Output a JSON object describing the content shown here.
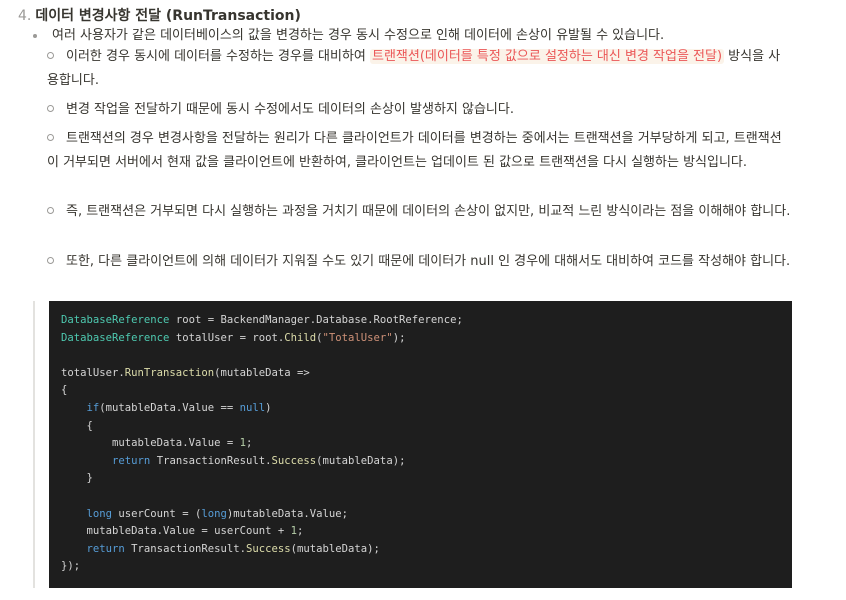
{
  "heading": {
    "number": "4.",
    "title": "데이터 변경사항 전달 (RunTransaction)"
  },
  "intro": "여러 사용자가 같은 데이터베이스의 값을 변경하는 경우 동시 수정으로 인해 데이터에 손상이 유발될 수 있습니다.",
  "sub_items": [
    {
      "before": "이러한 경우 동시에 데이터를 수정하는 경우를 대비하여 ",
      "highlight": "트랜잭션(데이터를 특정 값으로 설정하는 대신 변경 작업을 전달)",
      "after": " 방식을 사용합니다."
    },
    {
      "text": "변경 작업을 전달하기 때문에 동시 수정에서도 데이터의 손상이 발생하지 않습니다."
    },
    {
      "text": "트랜잭션의 경우 변경사항을 전달하는 원리가 다른 클라이언트가 데이터를 변경하는 중에서는 트랜잭션을 거부당하게 되고, 트랜잭션이 거부되면 서버에서 현재 값을 클라이언트에 반환하여, 클라이언트는 업데이트 된 값으로 트랜잭션을 다시 실행하는 방식입니다."
    },
    {
      "text": "즉, 트랜잭션은 거부되면 다시 실행하는 과정을 거치기 때문에 데이터의 손상이 없지만, 비교적 느린 방식이라는 점을 이해해야 합니다."
    },
    {
      "text": "또한, 다른 클라이언트에 의해 데이터가 지워질 수도 있기 때문에 데이터가 null 인 경우에 대해서도 대비하여 코드를 작성해야 합니다."
    }
  ],
  "code": {
    "var_root": "DatabaseReference",
    "root_assign": " root = BackendManager.Database.RootReference;",
    "var_total": "DatabaseReference",
    "total_assign_a": " totalUser = root.",
    "total_child": "Child",
    "total_paren_open": "(",
    "total_str": "\"TotalUser\"",
    "total_assign_b": ");",
    "run_prefix": "totalUser.",
    "run_method": "RunTransaction",
    "run_args": "(mutableData =>",
    "brace_open": "{",
    "if_kw": "if",
    "if_cond_a": "(mutableData.Value == ",
    "null_kw": "null",
    "if_cond_b": ")",
    "inner_open": "{",
    "assign_a": "mutableData.Value = ",
    "assign_num": "1",
    "assign_b": ";",
    "return_kw_1": "return",
    "return_a_1": " TransactionResult.",
    "success_1": "Success",
    "return_b_1": "(mutableData);",
    "inner_close": "}",
    "long_kw": "long",
    "count_a": " userCount = (",
    "long_kw_2": "long",
    "count_b": ")mutableData.Value;",
    "assign2_a": "mutableData.Value = userCount + ",
    "assign2_num": "1",
    "assign2_b": ";",
    "return_kw_2": "return",
    "return_a_2": " TransactionResult.",
    "success_2": "Success",
    "return_b_2": "(mutableData);",
    "brace_close": "});"
  },
  "colors": {
    "text": "#37352f",
    "highlight_text": "#eb5757",
    "highlight_bg": "#fbf3e9",
    "code_bg": "#1e1e1e",
    "code_type": "#4ec9b0",
    "code_keyword": "#569cd6",
    "code_string": "#ce9178",
    "code_number": "#b5cea8",
    "code_method": "#dcdcaa"
  }
}
